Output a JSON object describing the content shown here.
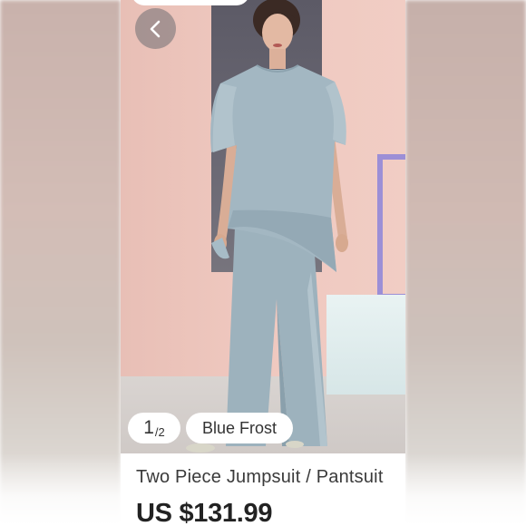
{
  "product": {
    "title": "Two Piece Jumpsuit / Pantsuit",
    "price": "US $131.99",
    "color_name": "Blue Frost",
    "image_index_current": "1",
    "image_index_total": "/2"
  },
  "icons": {
    "back": "chevron-left-icon"
  },
  "colors": {
    "dress": "#9fb3be",
    "pill_bg": "#ffffff",
    "back_button_bg": "#6e6e73"
  }
}
